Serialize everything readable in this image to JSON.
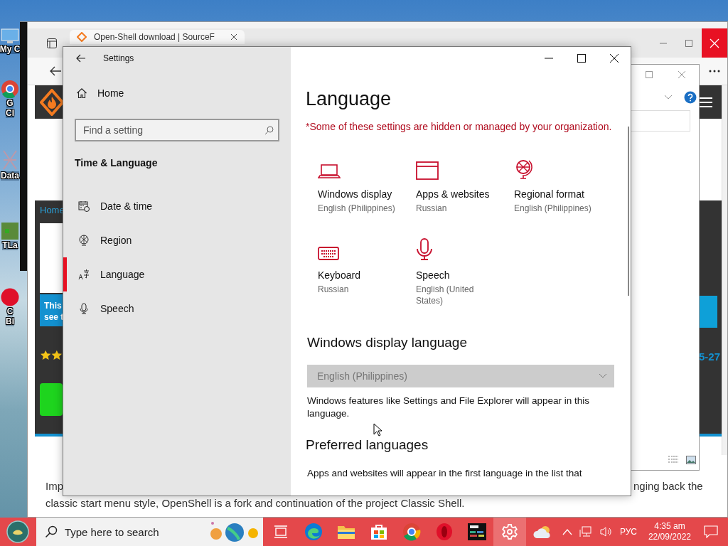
{
  "desktop_icons": [
    {
      "label_lines": [
        "My C"
      ],
      "kind": "computer"
    },
    {
      "label_lines": [
        "G",
        "Cl"
      ],
      "kind": "chrome"
    },
    {
      "label_lines": [
        "Data"
      ],
      "kind": "network"
    },
    {
      "label_lines": [
        "TLa"
      ],
      "kind": "game"
    },
    {
      "label_lines": [
        "C",
        "Bi"
      ],
      "kind": "circle"
    }
  ],
  "browser": {
    "tab_title": "Open-Shell download | SourceF",
    "page": {
      "home_link": "Home",
      "banner_lines": [
        "This",
        "see t"
      ],
      "side_text": "5-27",
      "paragraph_start": "Imp",
      "paragraph_end": "nging back the",
      "paragraph_line": "classic start menu style, OpenShell is a fork and continuation of the project Classic Shell."
    }
  },
  "settings": {
    "title": "Settings",
    "home": "Home",
    "search_placeholder": "Find a setting",
    "section": "Time & Language",
    "nav": [
      {
        "label": "Date & time",
        "kind": "date",
        "selected": false
      },
      {
        "label": "Region",
        "kind": "region",
        "selected": false
      },
      {
        "label": "Language",
        "kind": "language",
        "selected": true
      },
      {
        "label": "Speech",
        "kind": "speech",
        "selected": false
      }
    ],
    "heading": "Language",
    "notice": "*Some of these settings are hidden or managed by your organization.",
    "tiles": [
      {
        "kind": "laptop",
        "title": "Windows display",
        "subtitle": "English (Philippines)"
      },
      {
        "kind": "window",
        "title": "Apps & websites",
        "subtitle": "Russian"
      },
      {
        "kind": "globe",
        "title": "Regional format",
        "subtitle": "English (Philippines)"
      },
      {
        "kind": "keyboard",
        "title": "Keyboard",
        "subtitle": "Russian"
      },
      {
        "kind": "microphone",
        "title": "Speech",
        "subtitle": "English (United States)"
      }
    ],
    "display_language": {
      "heading": "Windows display language",
      "dropdown": {
        "value": "English (Philippines)",
        "disabled": true
      },
      "description": "Windows features like Settings and File Explorer will appear in this language."
    },
    "preferred": {
      "heading": "Preferred languages",
      "description": "Apps and websites will appear in the first language in the list that"
    }
  },
  "taskbar": {
    "search_placeholder": "Type here to search",
    "apps": [
      {
        "kind": "taskview",
        "selected": false
      },
      {
        "kind": "edge",
        "selected": false
      },
      {
        "kind": "folder",
        "selected": false
      },
      {
        "kind": "store",
        "selected": false
      },
      {
        "kind": "chrome",
        "selected": false
      },
      {
        "kind": "opera",
        "selected": false
      },
      {
        "kind": "terminal",
        "selected": false
      },
      {
        "kind": "settings",
        "selected": true
      },
      {
        "kind": "weather",
        "selected": false
      }
    ],
    "language": "РУС",
    "time": "4:35 am",
    "date": "22/09/2022"
  }
}
